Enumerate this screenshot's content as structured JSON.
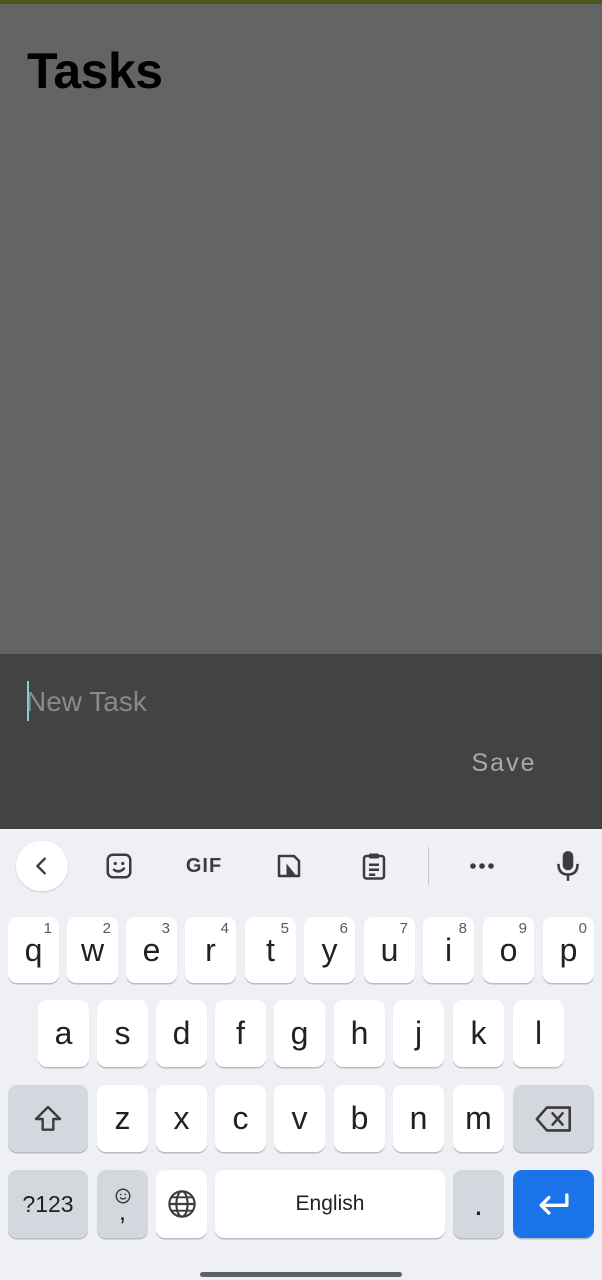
{
  "app": {
    "title": "Tasks"
  },
  "task_form": {
    "input_value": "",
    "input_placeholder": "New Task",
    "save_label": "Save"
  },
  "keyboard": {
    "toolbar": {
      "back_icon": "chevron-left-icon",
      "sticker_icon": "sticker-icon",
      "gif_label": "GIF",
      "translate_icon": "translate-icon",
      "clipboard_icon": "clipboard-icon",
      "more_icon": "more-horizontal-icon",
      "mic_icon": "microphone-icon"
    },
    "row1": [
      {
        "letter": "q",
        "hint": "1"
      },
      {
        "letter": "w",
        "hint": "2"
      },
      {
        "letter": "e",
        "hint": "3"
      },
      {
        "letter": "r",
        "hint": "4"
      },
      {
        "letter": "t",
        "hint": "5"
      },
      {
        "letter": "y",
        "hint": "6"
      },
      {
        "letter": "u",
        "hint": "7"
      },
      {
        "letter": "i",
        "hint": "8"
      },
      {
        "letter": "o",
        "hint": "9"
      },
      {
        "letter": "p",
        "hint": "0"
      }
    ],
    "row2": [
      "a",
      "s",
      "d",
      "f",
      "g",
      "h",
      "j",
      "k",
      "l"
    ],
    "row3": [
      "z",
      "x",
      "c",
      "v",
      "b",
      "n",
      "m"
    ],
    "symbols_label": "?123",
    "comma_label": ",",
    "space_label": "English",
    "period_label": "."
  },
  "colors": {
    "app_background": "#646464",
    "sheet_background": "#434343",
    "keyboard_background": "#eef0f5",
    "enter_key": "#1a73e8",
    "top_accent": "#4a5a1a"
  }
}
